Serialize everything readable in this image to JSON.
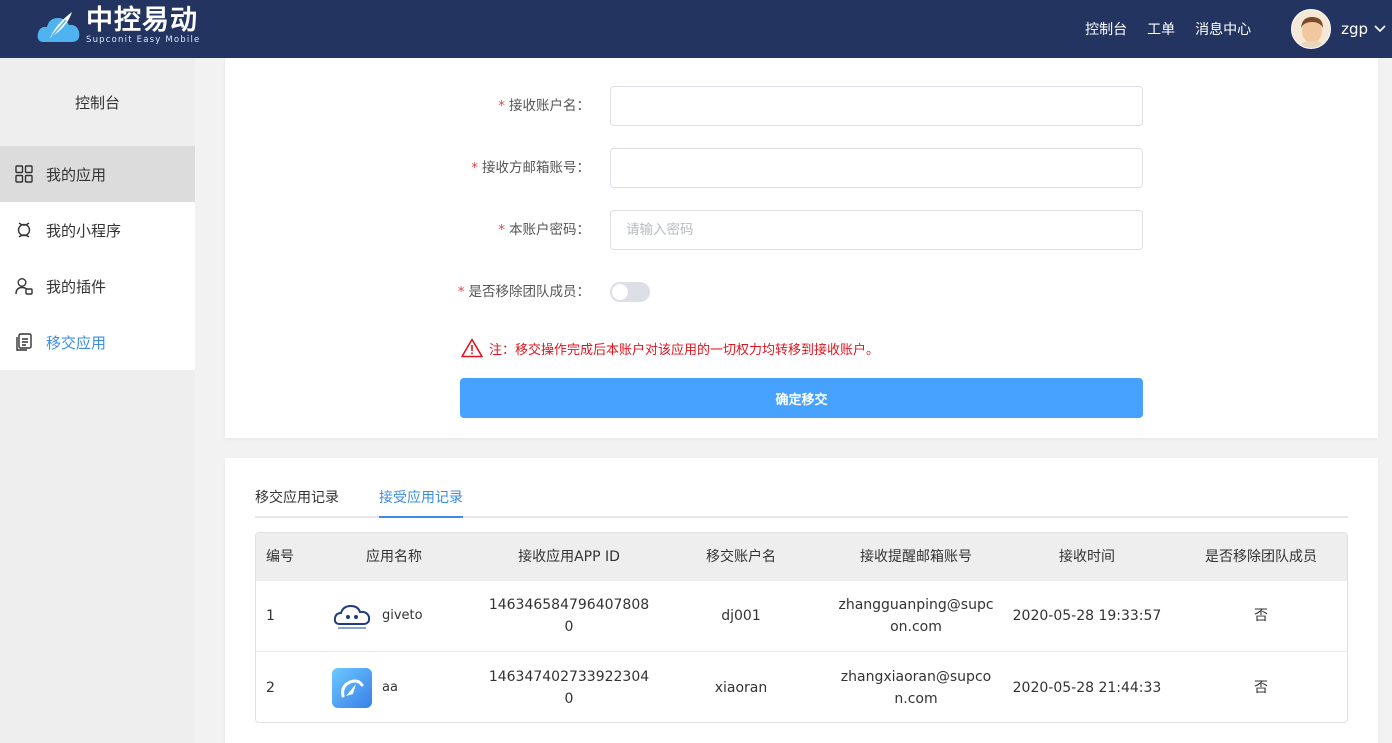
{
  "header": {
    "logo_title": "中控易动",
    "logo_subtitle": "Supconit Easy Mobile",
    "nav": [
      "控制台",
      "工单",
      "消息中心"
    ],
    "username": "zgp"
  },
  "sidebar": {
    "title": "控制台",
    "items": [
      {
        "label": "我的应用",
        "icon": "grid-icon"
      },
      {
        "label": "我的小程序",
        "icon": "mini-program-icon"
      },
      {
        "label": "我的插件",
        "icon": "plugin-user-icon"
      },
      {
        "label": "移交应用",
        "icon": "transfer-doc-icon"
      }
    ]
  },
  "form": {
    "receiver_account_label": "接收账户名：",
    "receiver_account_value": "",
    "receiver_email_label": "接收方邮箱账号：",
    "receiver_email_value": "",
    "password_label": "本账户密码：",
    "password_placeholder": "请输入密码",
    "remove_member_label": "是否移除团队成员：",
    "remove_member_on": false,
    "required_mark": "*",
    "warning": "注：移交操作完成后本账户对该应用的一切权力均转移到接收账户。",
    "submit_label": "确定移交"
  },
  "tabs": [
    "移交应用记录",
    "接受应用记录"
  ],
  "active_tab": "接受应用记录",
  "table": {
    "columns": [
      "编号",
      "应用名称",
      "接收应用APP ID",
      "移交账户名",
      "接收提醒邮箱账号",
      "接收时间",
      "是否移除团队成员"
    ],
    "rows": [
      {
        "no": "1",
        "app_name": "giveto",
        "app_id_1": "146346584796407808",
        "app_id_2": "0",
        "from_account": "dj001",
        "email_1": "zhangguanping@supc",
        "email_2": "on.com",
        "time": "2020-05-28 19:33:57",
        "removed": "否"
      },
      {
        "no": "2",
        "app_name": "aa",
        "app_id_1": "146347402733922304",
        "app_id_2": "0",
        "from_account": "xiaoran",
        "email_1": "zhangxiaoran@supco",
        "email_2": "n.com",
        "time": "2020-05-28 21:44:33",
        "removed": "否"
      }
    ]
  },
  "colors": {
    "header_bg": "#233461",
    "accent": "#3c8ce4",
    "submit_bg": "#46a1ff",
    "warning": "#e0141e"
  }
}
